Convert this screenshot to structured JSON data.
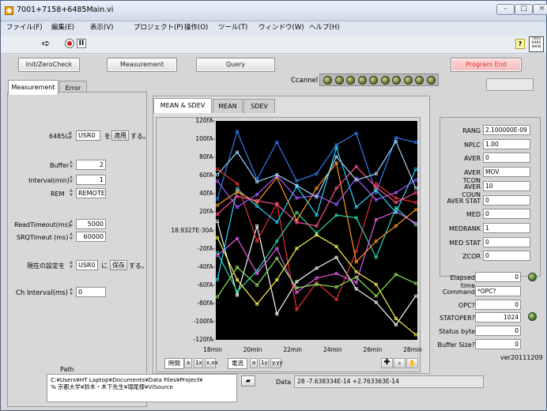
{
  "window": {
    "title": "7001+7158+6485Main.vi"
  },
  "menu": [
    "ファイル(F)",
    "編集(E)",
    "表示(V)",
    "プロジェクト(P)",
    "操作(O)",
    "ツール(T)",
    "ウィンドウ(W)",
    "ヘルプ(H)"
  ],
  "toolbar": {
    "badge": "7001\n6485\n⊟⊡⊟"
  },
  "buttons": {
    "init": "Init/ZeroCheck",
    "measurement": "Measurement",
    "query": "Query",
    "program_end": "Program End"
  },
  "ccannel": {
    "label": "Ccannel",
    "leds": 10
  },
  "tabs": {
    "outer": [
      "Measurement",
      "Error"
    ],
    "inner": [
      "MEAN & SDEV",
      "MEAN",
      "SDEV"
    ]
  },
  "left": {
    "range_label": "6485に",
    "range_value": "USR0",
    "range_mid": "を",
    "apply_button": "適用",
    "range_suffix": "する。",
    "buffer_label": "Buffer",
    "buffer_value": "2",
    "interval_label": "Interval(min)",
    "interval_value": "1",
    "rem_label": "REM",
    "rem_value": "REMOTE",
    "read_label": "ReadTimeout(ms)",
    "read_value": "5000",
    "srq_label": "SRQTimeut (ms)",
    "srq_value": "60000",
    "save_label": "現在の設定を",
    "save_value": "USR0",
    "save_mid": "に",
    "save_button": "保存",
    "save_suffix": "する。",
    "ch_label": "Ch Interval(ms)",
    "ch_value": "0"
  },
  "plot": {
    "y_ticks": [
      "120fA-",
      "100fA-",
      "80fA-",
      "60fA-",
      "40fA-",
      "20fA-",
      "18.9327E-30A-",
      "-20fA-",
      "-40fA-",
      "-60fA-",
      "-80fA-",
      "-100fA-",
      "-120fA-"
    ],
    "x_ticks": [
      "18min",
      "20min",
      "22min",
      "24min",
      "26min",
      "28min"
    ],
    "x_label": "時間",
    "y_label": "電流",
    "legend_icons": [
      "a",
      "1x",
      "x.xx",
      "a",
      "1y",
      "y.yy"
    ]
  },
  "chart_data": {
    "type": "line",
    "x": [
      18,
      19,
      20,
      21,
      22,
      23,
      24,
      25,
      26,
      27,
      28
    ],
    "xlabel": "時間",
    "ylabel": "電流",
    "ylim": [
      -120,
      120
    ],
    "series": [
      {
        "color": "#2f7df0",
        "values": [
          35,
          110,
          57,
          98,
          55,
          63,
          95,
          108,
          42,
          103,
          98
        ]
      },
      {
        "color": "#f9f9f9",
        "values": [
          10,
          -72,
          5,
          -93,
          -57,
          -42,
          -30,
          -65,
          -80,
          -105,
          -73
        ]
      },
      {
        "color": "#ee2f2f",
        "values": [
          68,
          52,
          -12,
          30,
          -88,
          -58,
          -77,
          -23,
          52,
          36,
          31
        ]
      },
      {
        "color": "#2dd6a8",
        "values": [
          -25,
          -68,
          -45,
          -12,
          20,
          -3,
          17,
          14,
          -30,
          25,
          6
        ]
      },
      {
        "color": "#e85bea",
        "values": [
          -28,
          -9,
          -48,
          -20,
          -69,
          -53,
          -48,
          -58,
          12,
          21,
          8
        ]
      },
      {
        "color": "#fff64e",
        "values": [
          -8,
          -55,
          -82,
          -55,
          -20,
          -5,
          -18,
          -46,
          -60,
          -98,
          -116
        ]
      },
      {
        "color": "#24d7ff",
        "values": [
          -55,
          46,
          27,
          9,
          49,
          17,
          92,
          26,
          45,
          20,
          68
        ]
      },
      {
        "color": "#ff9a1c",
        "values": [
          28,
          43,
          31,
          59,
          11,
          47,
          75,
          -35,
          -12,
          5,
          23
        ]
      },
      {
        "color": "#8de85b",
        "values": [
          -74,
          -41,
          -61,
          -31,
          -64,
          -60,
          -63,
          -52,
          -73,
          -49,
          -59
        ]
      },
      {
        "color": "#a85aff",
        "values": [
          55,
          26,
          40,
          61,
          36,
          39,
          29,
          58,
          34,
          42,
          56
        ]
      },
      {
        "color": "#ff4f92",
        "values": [
          18,
          38,
          33,
          29,
          9,
          5,
          47,
          71,
          48,
          31,
          42
        ]
      },
      {
        "color": "#9ed6ff",
        "values": [
          62,
          87,
          54,
          62,
          50,
          37,
          82,
          56,
          63,
          99,
          47
        ]
      }
    ]
  },
  "right": {
    "rows": [
      {
        "label": "RANG",
        "value": "2.100000E-09"
      },
      {
        "label": "NPLC",
        "value": "1.00"
      },
      {
        "label": "AVER",
        "value": "0"
      },
      {
        "label": "AVER TCON",
        "value": "MOV"
      },
      {
        "label": "AVER COUN",
        "value": "10"
      },
      {
        "label": "AVER STAT",
        "value": "0"
      },
      {
        "label": "MED",
        "value": "0"
      },
      {
        "label": "MEDRANK",
        "value": "1"
      },
      {
        "label": "MED STAT",
        "value": "0"
      },
      {
        "label": "ZCOR",
        "value": "0"
      }
    ],
    "elapsed_label": "Elapsed time",
    "elapsed_value": "0",
    "command_label": "Command",
    "command_value": "*OPC?",
    "opc_label": "OPC?",
    "opc_value": "0",
    "stat_label": "STATOPER?",
    "stat_value": "1024",
    "status_label": "Status byte",
    "status_value": "0",
    "buffer_label": "Buffer Size?",
    "buffer_value": "0",
    "version": "ver20111209"
  },
  "bottom": {
    "path_label": "Path",
    "path_line1": "C:¥Users¥HT Laptop¥Documents¥Data Files¥Project¥",
    "path_line2": "% 京都大学¥鈴木・木下先生¥堀尾様¥ViSource",
    "data_label": "Data",
    "data_value": "28 -7.638334E-14 +2.763363E-14"
  }
}
